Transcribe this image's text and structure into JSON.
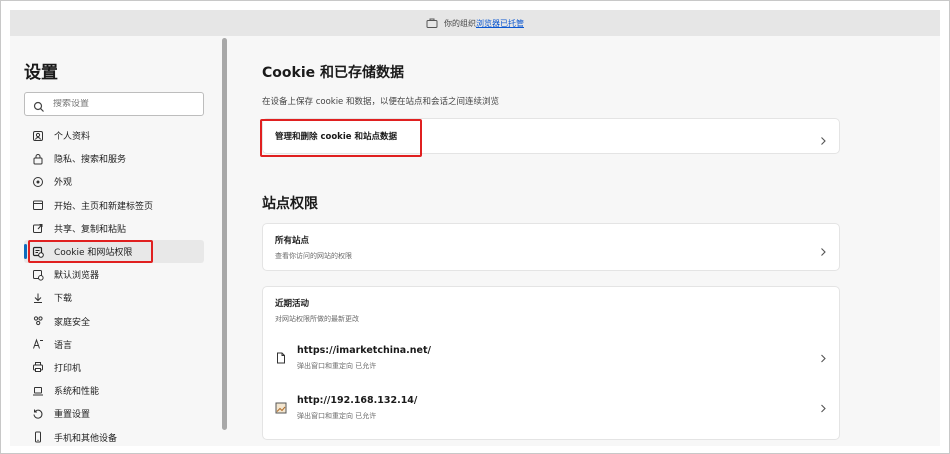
{
  "infobar": {
    "prefix": "你的组织",
    "link": "浏览器已托管"
  },
  "sidebar": {
    "title": "设置",
    "search_placeholder": "搜索设置",
    "items": [
      {
        "label": "个人资料",
        "icon": "profile-icon"
      },
      {
        "label": "隐私、搜索和服务",
        "icon": "lock-icon"
      },
      {
        "label": "外观",
        "icon": "appearance-icon"
      },
      {
        "label": "开始、主页和新建标签页",
        "icon": "home-icon"
      },
      {
        "label": "共享、复制和粘贴",
        "icon": "share-icon"
      },
      {
        "label": "Cookie 和网站权限",
        "icon": "cookie-icon"
      },
      {
        "label": "默认浏览器",
        "icon": "browser-icon"
      },
      {
        "label": "下载",
        "icon": "download-icon"
      },
      {
        "label": "家庭安全",
        "icon": "family-icon"
      },
      {
        "label": "语言",
        "icon": "language-icon"
      },
      {
        "label": "打印机",
        "icon": "printer-icon"
      },
      {
        "label": "系统和性能",
        "icon": "laptop-icon"
      },
      {
        "label": "重置设置",
        "icon": "reset-icon"
      },
      {
        "label": "手机和其他设备",
        "icon": "phone-icon"
      }
    ]
  },
  "cookies": {
    "title": "Cookie 和已存储数据",
    "desc": "在设备上保存 cookie 和数据，以便在站点和会话之间连续浏览",
    "manage_label": "管理和删除 cookie 和站点数据"
  },
  "permissions": {
    "title": "站点权限",
    "all_sites": {
      "title": "所有站点",
      "sub": "查看你访问的网站的权限"
    },
    "recent": {
      "title": "近期活动",
      "sub": "对网站权限所做的最新更改"
    },
    "sites": [
      {
        "url": "https://imarketchina.net/",
        "sub": "弹出窗口和重定向 已允许",
        "icon": "file-icon"
      },
      {
        "url": "http://192.168.132.14/",
        "sub": "弹出窗口和重定向 已允许",
        "icon": "image-icon"
      }
    ]
  },
  "colors": {
    "accent": "#0f6cbd",
    "highlight": "#e02020"
  }
}
